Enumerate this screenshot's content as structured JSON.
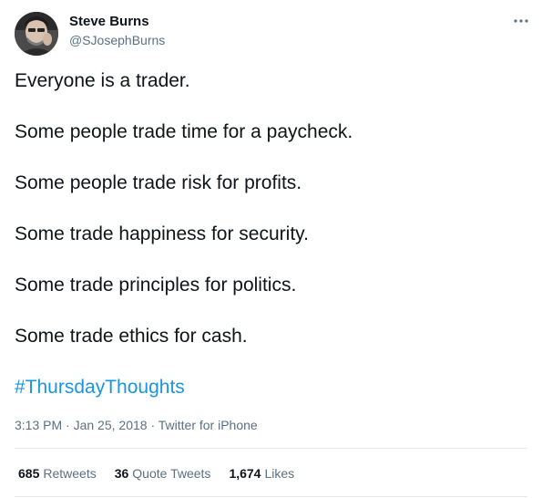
{
  "author": {
    "name": "Steve Burns",
    "handle": "@SJosephBurns"
  },
  "tweet": {
    "lines": [
      "Everyone is a trader.",
      "Some people trade time for a paycheck.",
      "Some people trade risk for profits.",
      "Some trade happiness for security.",
      "Some trade principles for politics.",
      "Some trade ethics for cash."
    ],
    "hashtag": "#ThursdayThoughts"
  },
  "meta": {
    "time": "3:13 PM",
    "separator": " · ",
    "date": "Jan 25, 2018",
    "source": "Twitter for iPhone"
  },
  "stats": {
    "retweets_count": "685",
    "retweets_label": "Retweets",
    "quotes_count": "36",
    "quotes_label": "Quote Tweets",
    "likes_count": "1,674",
    "likes_label": "Likes"
  },
  "colors": {
    "text": "#0f1419",
    "secondary": "#5b7083",
    "link": "#1b95e0",
    "divider": "#e3e7ea"
  },
  "icons": {
    "more": "more-horizontal-icon"
  }
}
